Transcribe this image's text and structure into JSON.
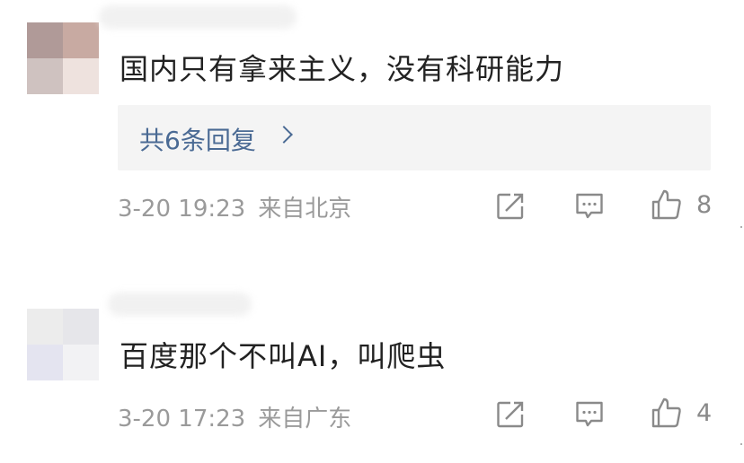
{
  "comments": [
    {
      "text": "国内只有拿来主义，没有科研能力",
      "replies_label": "共6条回复",
      "time": "3-20 19:23",
      "location": "来自北京",
      "likes": "8",
      "avatar_colors": [
        "#b09a98",
        "#c8aaa2",
        "#cfc2c0",
        "#eee2de"
      ]
    },
    {
      "text": "百度那个不叫AI，叫爬虫",
      "time": "3-20 17:23",
      "location": "来自广东",
      "likes": "4",
      "avatar_colors": [
        "#ececec",
        "#e6e6ea",
        "#e4e4f0",
        "#f2f2f4"
      ]
    }
  ],
  "icons": {
    "share": "share-icon",
    "comment": "comment-icon",
    "like": "thumbs-up-icon"
  },
  "colors": {
    "text": "#222222",
    "meta": "#9a9a9a",
    "reply_link": "#4a6a94",
    "reply_bg": "#f4f4f4",
    "icon": "#8a8a8a"
  }
}
